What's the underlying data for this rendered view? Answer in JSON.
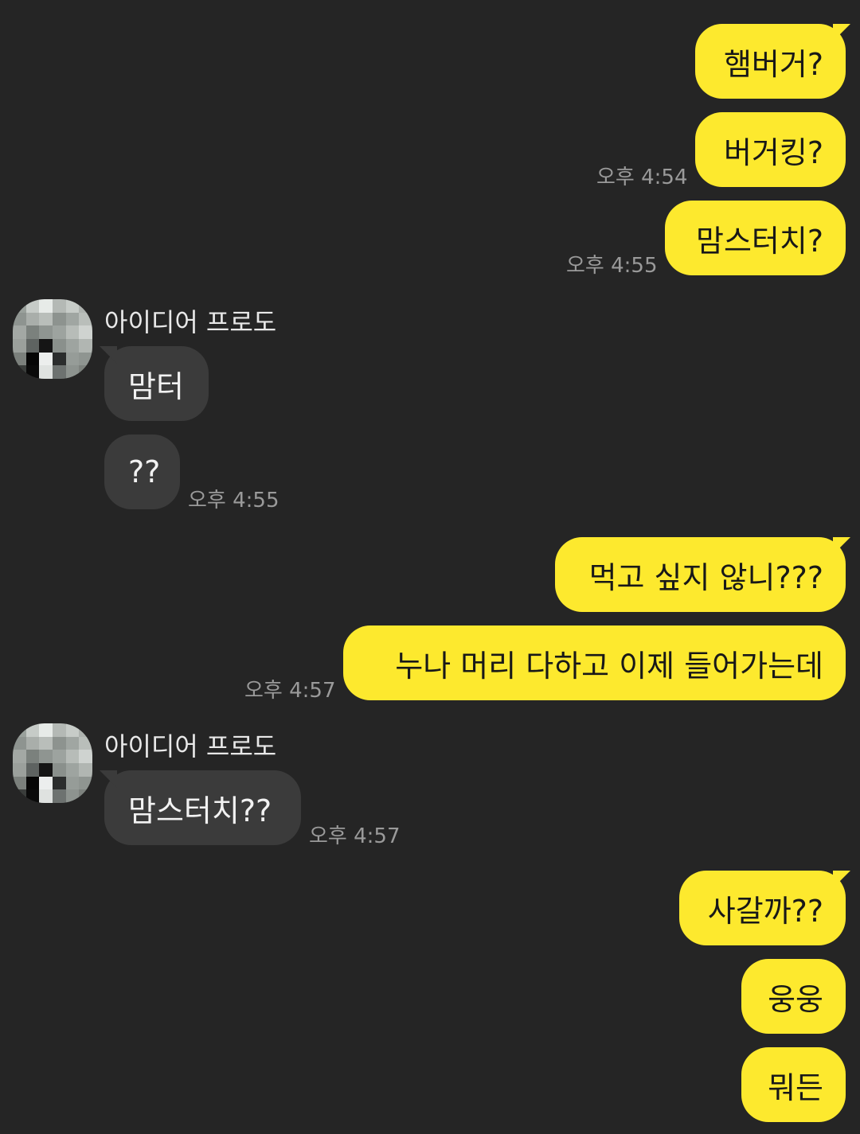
{
  "messages": {
    "m1": "햄버거?",
    "m2": "버거킹?",
    "m3": "맘스터치?",
    "m4": "맘터",
    "m5": "??",
    "m6": "먹고 싶지 않니???",
    "m7": "누나 머리 다하고 이제 들어가는데",
    "m8": "맘스터치??",
    "m9": "사갈까??",
    "m10": "웅웅",
    "m11": "뭐든"
  },
  "times": {
    "t1": "오후 4:54",
    "t2": "오후 4:55",
    "t3": "오후 4:55",
    "t4": "오후 4:57",
    "t5": "오후 4:57"
  },
  "contact": {
    "name_1": "아이디어 프로도",
    "name_2": "아이디어 프로도"
  },
  "colors": {
    "background": "#252525",
    "outgoing_bubble": "#fde92e",
    "incoming_bubble": "#3b3b3b",
    "timestamp": "#9a9a9a"
  }
}
